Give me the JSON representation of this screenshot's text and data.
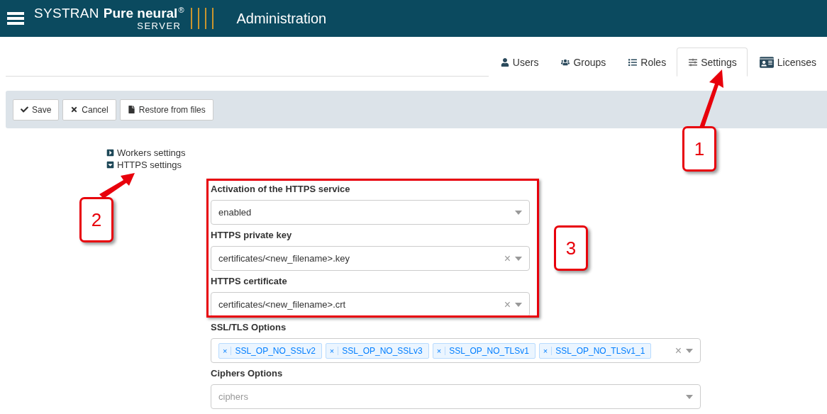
{
  "header": {
    "brand_light": "SYSTRAN",
    "brand_bold": "Pure neural",
    "brand_mark": "®",
    "brand_sub": "SERVER",
    "title": "Administration"
  },
  "tabs": [
    {
      "label": "Users",
      "selected": false
    },
    {
      "label": "Groups",
      "selected": false
    },
    {
      "label": "Roles",
      "selected": false
    },
    {
      "label": "Settings",
      "selected": true
    },
    {
      "label": "Licenses",
      "selected": false
    }
  ],
  "toolbar": [
    {
      "label": "Save"
    },
    {
      "label": "Cancel"
    },
    {
      "label": "Restore from files"
    }
  ],
  "tree": [
    {
      "label": "Workers settings",
      "expanded": false
    },
    {
      "label": "HTTPS settings",
      "expanded": true
    }
  ],
  "fields": [
    {
      "kind": "select",
      "label": "Activation of the HTTPS service",
      "value": "enabled",
      "clearable": false
    },
    {
      "kind": "select",
      "label": "HTTPS private key",
      "value": "certificates/<new_filename>.key",
      "clearable": true
    },
    {
      "kind": "select",
      "label": "HTTPS certificate",
      "value": "certificates/<new_filename>.crt",
      "clearable": true
    },
    {
      "kind": "tags",
      "label": "SSL/TLS Options",
      "tags": [
        "SSL_OP_NO_SSLv2",
        "SSL_OP_NO_SSLv3",
        "SSL_OP_NO_TLSv1",
        "SSL_OP_NO_TLSv1_1"
      ],
      "tag_remove": "×",
      "clearable": true
    },
    {
      "kind": "select",
      "label": "Ciphers Options",
      "placeholder": "ciphers",
      "clearable": false
    }
  ],
  "clear_symbol": "×",
  "callouts": [
    {
      "label": "1"
    },
    {
      "label": "2"
    },
    {
      "label": "3"
    }
  ]
}
